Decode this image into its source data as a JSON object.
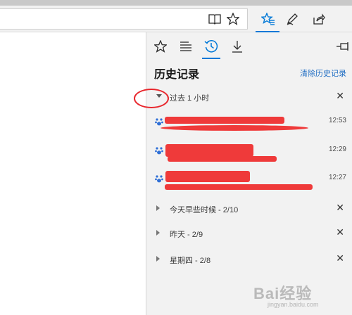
{
  "hub": {
    "title": "历史记录",
    "clear_label": "清除历史记录"
  },
  "groups": [
    {
      "label": "过去 1 小时",
      "expanded": true
    },
    {
      "label": "今天早些时候 - 2/10",
      "expanded": false
    },
    {
      "label": "昨天 - 2/9",
      "expanded": false
    },
    {
      "label": "星期四 - 2/8",
      "expanded": false
    }
  ],
  "entries": [
    {
      "time": "12:53",
      "favicon": "baidu-paw-icon",
      "redacted": true
    },
    {
      "time": "12:29",
      "favicon": "baidu-paw-icon",
      "redacted": true
    },
    {
      "time": "12:27",
      "favicon": "baidu-paw-icon",
      "redacted": true
    }
  ],
  "close_glyph": "✕",
  "icons": [
    "reading-view-icon",
    "favorite-star-icon",
    "hub-icon",
    "pen-icon",
    "share-icon",
    "pin-icon",
    "favorites-tab-icon",
    "reading-list-icon",
    "history-icon",
    "downloads-icon"
  ],
  "colors": {
    "accent": "#0078d7",
    "link": "#1d6cc3",
    "redaction": "#ef3a3a",
    "annotation": "#e8262c"
  },
  "watermark": {
    "brand": "Bai经验",
    "url": "jingyan.baidu.com"
  }
}
